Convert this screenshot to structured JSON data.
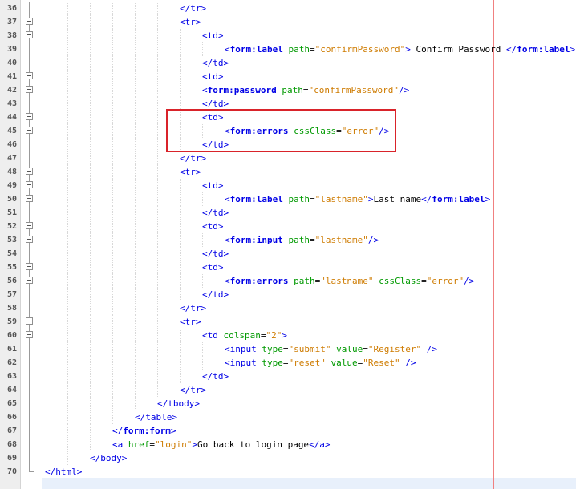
{
  "editor": {
    "colors": {
      "tag": "#0000e6",
      "attribute": "#009900",
      "value": "#ce7b00",
      "text": "#000000",
      "margin_line": "#f08080",
      "highlight_box": "#d9232a"
    },
    "fold_icon": "minus-box-icon",
    "lines": [
      {
        "n": "36",
        "indent": 6,
        "fold": "line",
        "tokens": [
          {
            "t": "tg",
            "v": "</tr>"
          }
        ]
      },
      {
        "n": "37",
        "indent": 6,
        "fold": "box",
        "tokens": [
          {
            "t": "tg",
            "v": "<tr>"
          }
        ]
      },
      {
        "n": "38",
        "indent": 7,
        "fold": "box",
        "tokens": [
          {
            "t": "tg",
            "v": "<td>"
          }
        ]
      },
      {
        "n": "39",
        "indent": 8,
        "fold": "line",
        "tokens": [
          {
            "t": "tg",
            "v": "<"
          },
          {
            "t": "tn",
            "v": "form:label"
          },
          {
            "t": "tx",
            "v": " "
          },
          {
            "t": "at",
            "v": "path"
          },
          {
            "t": "tx",
            "v": "="
          },
          {
            "t": "vl",
            "v": "\"confirmPassword\""
          },
          {
            "t": "tg",
            "v": ">"
          },
          {
            "t": "tx",
            "v": " Confirm Password "
          },
          {
            "t": "tg",
            "v": "</"
          },
          {
            "t": "tn",
            "v": "form:label"
          },
          {
            "t": "tg",
            "v": ">"
          }
        ]
      },
      {
        "n": "40",
        "indent": 7,
        "fold": "line",
        "tokens": [
          {
            "t": "tg",
            "v": "</td>"
          }
        ]
      },
      {
        "n": "41",
        "indent": 7,
        "fold": "box",
        "tokens": [
          {
            "t": "tg",
            "v": "<td>"
          }
        ]
      },
      {
        "n": "42",
        "indent": 7,
        "fold": "box",
        "tokens": [
          {
            "t": "tg",
            "v": "<"
          },
          {
            "t": "tn",
            "v": "form:password"
          },
          {
            "t": "tx",
            "v": " "
          },
          {
            "t": "at",
            "v": "path"
          },
          {
            "t": "tx",
            "v": "="
          },
          {
            "t": "vl",
            "v": "\"confirmPassword\""
          },
          {
            "t": "tg",
            "v": "/>"
          }
        ]
      },
      {
        "n": "43",
        "indent": 7,
        "fold": "line",
        "tokens": [
          {
            "t": "tg",
            "v": "</td>"
          }
        ]
      },
      {
        "n": "44",
        "indent": 7,
        "fold": "box",
        "tokens": [
          {
            "t": "tg",
            "v": "<td>"
          }
        ]
      },
      {
        "n": "45",
        "indent": 8,
        "fold": "box",
        "tokens": [
          {
            "t": "tg",
            "v": "<"
          },
          {
            "t": "tn",
            "v": "form:errors"
          },
          {
            "t": "tx",
            "v": " "
          },
          {
            "t": "at",
            "v": "cssClass"
          },
          {
            "t": "tx",
            "v": "="
          },
          {
            "t": "vl",
            "v": "\"error\""
          },
          {
            "t": "tg",
            "v": "/>"
          }
        ]
      },
      {
        "n": "46",
        "indent": 7,
        "fold": "line",
        "tokens": [
          {
            "t": "tg",
            "v": "</td>"
          }
        ]
      },
      {
        "n": "47",
        "indent": 6,
        "fold": "line",
        "tokens": [
          {
            "t": "tg",
            "v": "</tr>"
          }
        ]
      },
      {
        "n": "48",
        "indent": 6,
        "fold": "box",
        "tokens": [
          {
            "t": "tg",
            "v": "<tr>"
          }
        ]
      },
      {
        "n": "49",
        "indent": 7,
        "fold": "box",
        "tokens": [
          {
            "t": "tg",
            "v": "<td>"
          }
        ]
      },
      {
        "n": "50",
        "indent": 8,
        "fold": "box",
        "tokens": [
          {
            "t": "tg",
            "v": "<"
          },
          {
            "t": "tn",
            "v": "form:label"
          },
          {
            "t": "tx",
            "v": " "
          },
          {
            "t": "at",
            "v": "path"
          },
          {
            "t": "tx",
            "v": "="
          },
          {
            "t": "vl",
            "v": "\"lastname\""
          },
          {
            "t": "tg",
            "v": ">"
          },
          {
            "t": "tx",
            "v": "Last name"
          },
          {
            "t": "tg",
            "v": "</"
          },
          {
            "t": "tn",
            "v": "form:label"
          },
          {
            "t": "tg",
            "v": ">"
          }
        ]
      },
      {
        "n": "51",
        "indent": 7,
        "fold": "line",
        "tokens": [
          {
            "t": "tg",
            "v": "</td>"
          }
        ]
      },
      {
        "n": "52",
        "indent": 7,
        "fold": "box",
        "tokens": [
          {
            "t": "tg",
            "v": "<td>"
          }
        ]
      },
      {
        "n": "53",
        "indent": 8,
        "fold": "box",
        "tokens": [
          {
            "t": "tg",
            "v": "<"
          },
          {
            "t": "tn",
            "v": "form:input"
          },
          {
            "t": "tx",
            "v": " "
          },
          {
            "t": "at",
            "v": "path"
          },
          {
            "t": "tx",
            "v": "="
          },
          {
            "t": "vl",
            "v": "\"lastname\""
          },
          {
            "t": "tg",
            "v": "/>"
          }
        ]
      },
      {
        "n": "54",
        "indent": 7,
        "fold": "line",
        "tokens": [
          {
            "t": "tg",
            "v": "</td>"
          }
        ]
      },
      {
        "n": "55",
        "indent": 7,
        "fold": "box",
        "tokens": [
          {
            "t": "tg",
            "v": "<td>"
          }
        ]
      },
      {
        "n": "56",
        "indent": 8,
        "fold": "box",
        "tokens": [
          {
            "t": "tg",
            "v": "<"
          },
          {
            "t": "tn",
            "v": "form:errors"
          },
          {
            "t": "tx",
            "v": " "
          },
          {
            "t": "at",
            "v": "path"
          },
          {
            "t": "tx",
            "v": "="
          },
          {
            "t": "vl",
            "v": "\"lastname\""
          },
          {
            "t": "tx",
            "v": " "
          },
          {
            "t": "at",
            "v": "cssClass"
          },
          {
            "t": "tx",
            "v": "="
          },
          {
            "t": "vl",
            "v": "\"error\""
          },
          {
            "t": "tg",
            "v": "/>"
          }
        ]
      },
      {
        "n": "57",
        "indent": 7,
        "fold": "line",
        "tokens": [
          {
            "t": "tg",
            "v": "</td>"
          }
        ]
      },
      {
        "n": "58",
        "indent": 6,
        "fold": "line",
        "tokens": [
          {
            "t": "tg",
            "v": "</tr>"
          }
        ]
      },
      {
        "n": "59",
        "indent": 6,
        "fold": "box",
        "tokens": [
          {
            "t": "tg",
            "v": "<tr>"
          }
        ]
      },
      {
        "n": "60",
        "indent": 7,
        "fold": "box",
        "tokens": [
          {
            "t": "tg",
            "v": "<td "
          },
          {
            "t": "at",
            "v": "colspan"
          },
          {
            "t": "tx",
            "v": "="
          },
          {
            "t": "vl",
            "v": "\"2\""
          },
          {
            "t": "tg",
            "v": ">"
          }
        ]
      },
      {
        "n": "61",
        "indent": 8,
        "fold": "line",
        "tokens": [
          {
            "t": "tg",
            "v": "<input "
          },
          {
            "t": "at",
            "v": "type"
          },
          {
            "t": "tx",
            "v": "="
          },
          {
            "t": "vl",
            "v": "\"submit\""
          },
          {
            "t": "tx",
            "v": " "
          },
          {
            "t": "at",
            "v": "value"
          },
          {
            "t": "tx",
            "v": "="
          },
          {
            "t": "vl",
            "v": "\"Register\""
          },
          {
            "t": "tx",
            "v": " "
          },
          {
            "t": "tg",
            "v": "/>"
          }
        ]
      },
      {
        "n": "62",
        "indent": 8,
        "fold": "line",
        "tokens": [
          {
            "t": "tg",
            "v": "<input "
          },
          {
            "t": "at",
            "v": "type"
          },
          {
            "t": "tx",
            "v": "="
          },
          {
            "t": "vl",
            "v": "\"reset\""
          },
          {
            "t": "tx",
            "v": " "
          },
          {
            "t": "at",
            "v": "value"
          },
          {
            "t": "tx",
            "v": "="
          },
          {
            "t": "vl",
            "v": "\"Reset\""
          },
          {
            "t": "tx",
            "v": " "
          },
          {
            "t": "tg",
            "v": "/>"
          }
        ]
      },
      {
        "n": "63",
        "indent": 7,
        "fold": "line",
        "tokens": [
          {
            "t": "tg",
            "v": "</td>"
          }
        ]
      },
      {
        "n": "64",
        "indent": 6,
        "fold": "line",
        "tokens": [
          {
            "t": "tg",
            "v": "</tr>"
          }
        ]
      },
      {
        "n": "65",
        "indent": 5,
        "fold": "line",
        "tokens": [
          {
            "t": "tg",
            "v": "</tbody>"
          }
        ]
      },
      {
        "n": "66",
        "indent": 4,
        "fold": "line",
        "tokens": [
          {
            "t": "tg",
            "v": "</table>"
          }
        ]
      },
      {
        "n": "67",
        "indent": 3,
        "fold": "line",
        "tokens": [
          {
            "t": "tg",
            "v": "</"
          },
          {
            "t": "tn",
            "v": "form:form"
          },
          {
            "t": "tg",
            "v": ">"
          }
        ]
      },
      {
        "n": "68",
        "indent": 3,
        "fold": "line",
        "tokens": [
          {
            "t": "tg",
            "v": "<a "
          },
          {
            "t": "at",
            "v": "href"
          },
          {
            "t": "tx",
            "v": "="
          },
          {
            "t": "vl",
            "v": "\"login\""
          },
          {
            "t": "tg",
            "v": ">"
          },
          {
            "t": "tx",
            "v": "Go back to login page"
          },
          {
            "t": "tg",
            "v": "</a>"
          }
        ]
      },
      {
        "n": "69",
        "indent": 2,
        "fold": "line",
        "tokens": [
          {
            "t": "tg",
            "v": "</body>"
          }
        ]
      },
      {
        "n": "70",
        "indent": 0,
        "fold": "end",
        "tokens": [
          {
            "t": "tg",
            "v": "</html>"
          }
        ]
      }
    ]
  }
}
